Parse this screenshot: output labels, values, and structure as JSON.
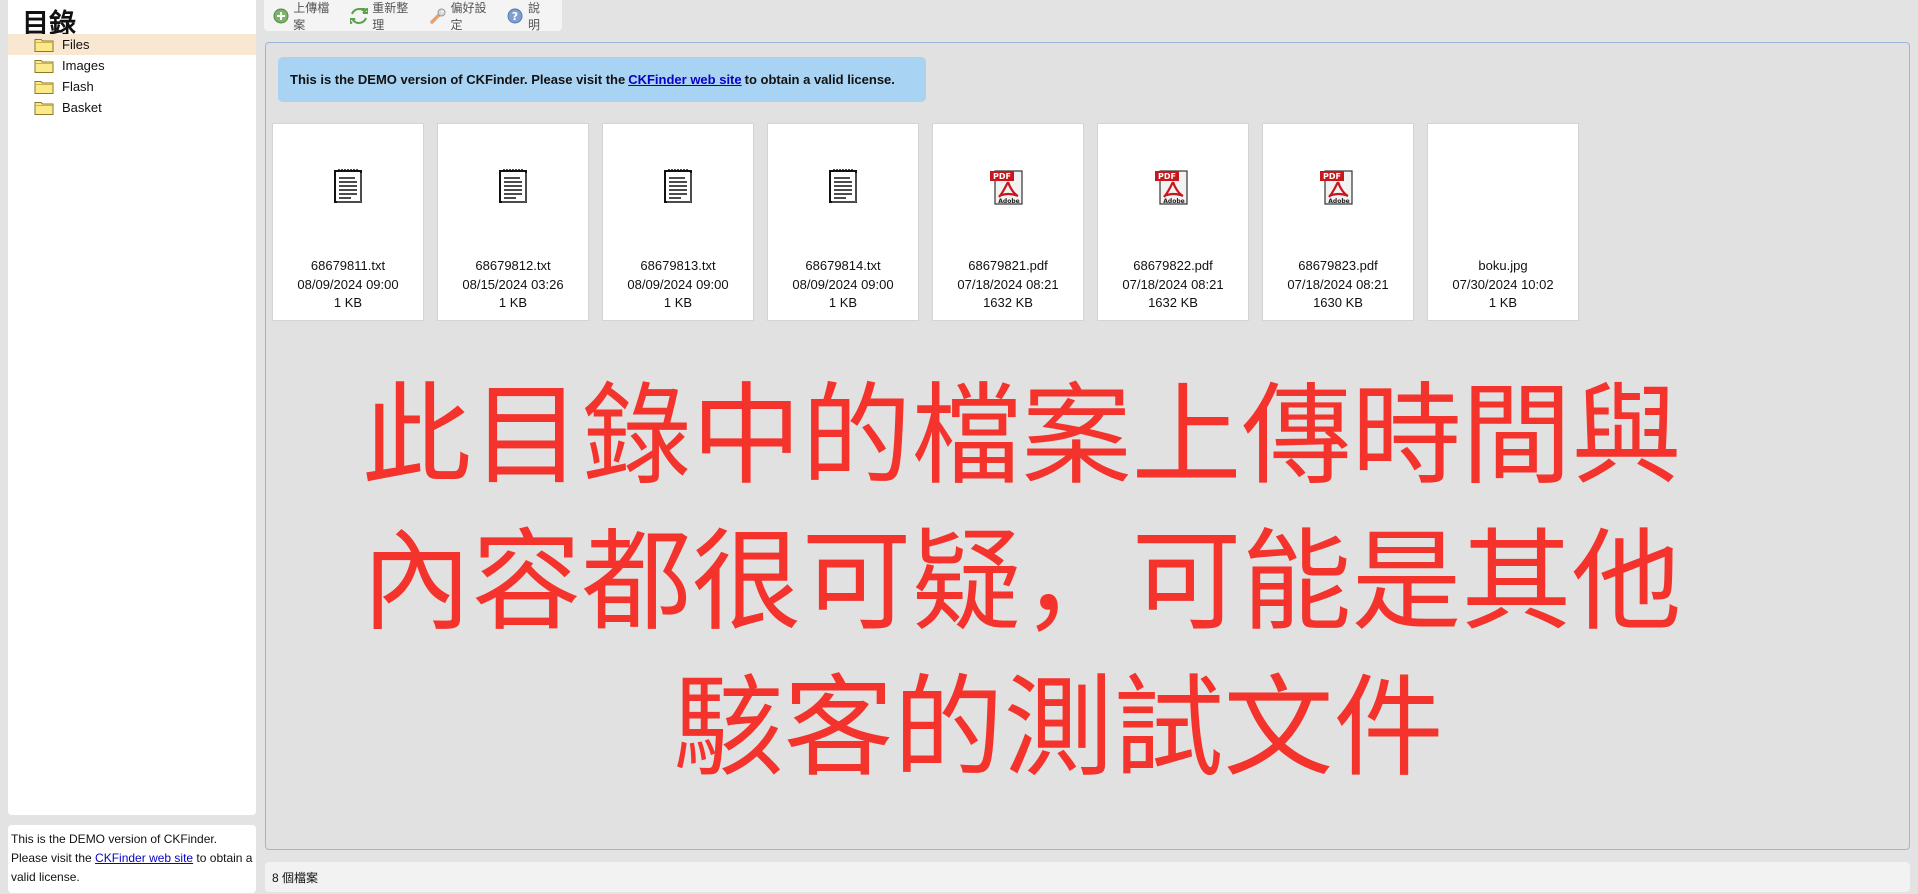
{
  "folder_panel": {
    "title": "目錄",
    "folders": [
      {
        "label": "Files",
        "selected": true
      },
      {
        "label": "Images",
        "selected": false
      },
      {
        "label": "Flash",
        "selected": false
      },
      {
        "label": "Basket",
        "selected": false
      }
    ],
    "license": {
      "pre": "This is the DEMO version of CKFinder. Please visit the ",
      "link": "CKFinder web site",
      "post": " to obtain a valid license."
    }
  },
  "toolbar": {
    "upload": {
      "label": "上傳檔案",
      "icon": "upload-plus-icon"
    },
    "refresh": {
      "label": "重新整理",
      "icon": "refresh-arrows-icon"
    },
    "settings": {
      "label": "偏好設定",
      "icon": "wrench-icon"
    },
    "help": {
      "label": "說明",
      "icon": "help-question-icon"
    }
  },
  "files_pane": {
    "banner": {
      "pre": "This is the DEMO version of CKFinder. Please visit the",
      "link": "CKFinder web site",
      "post": "to obtain a valid license."
    },
    "files": [
      {
        "name": "68679811.txt",
        "date": "08/09/2024 09:00",
        "size": "1 KB",
        "type": "txt"
      },
      {
        "name": "68679812.txt",
        "date": "08/15/2024 03:26",
        "size": "1 KB",
        "type": "txt"
      },
      {
        "name": "68679813.txt",
        "date": "08/09/2024 09:00",
        "size": "1 KB",
        "type": "txt"
      },
      {
        "name": "68679814.txt",
        "date": "08/09/2024 09:00",
        "size": "1 KB",
        "type": "txt"
      },
      {
        "name": "68679821.pdf",
        "date": "07/18/2024 08:21",
        "size": "1632 KB",
        "type": "pdf"
      },
      {
        "name": "68679822.pdf",
        "date": "07/18/2024 08:21",
        "size": "1632 KB",
        "type": "pdf"
      },
      {
        "name": "68679823.pdf",
        "date": "07/18/2024 08:21",
        "size": "1630 KB",
        "type": "pdf"
      },
      {
        "name": "boku.jpg",
        "date": "07/30/2024 10:02",
        "size": "1 KB",
        "type": "jpg"
      }
    ],
    "overlay": {
      "line1": "此目錄中的檔案上傳時間與",
      "line2": "內容都很可疑，可能是其他",
      "line3": "駭客的測試文件",
      "color": "#f4342c"
    }
  },
  "status_bar": {
    "text": "8 個檔案"
  }
}
